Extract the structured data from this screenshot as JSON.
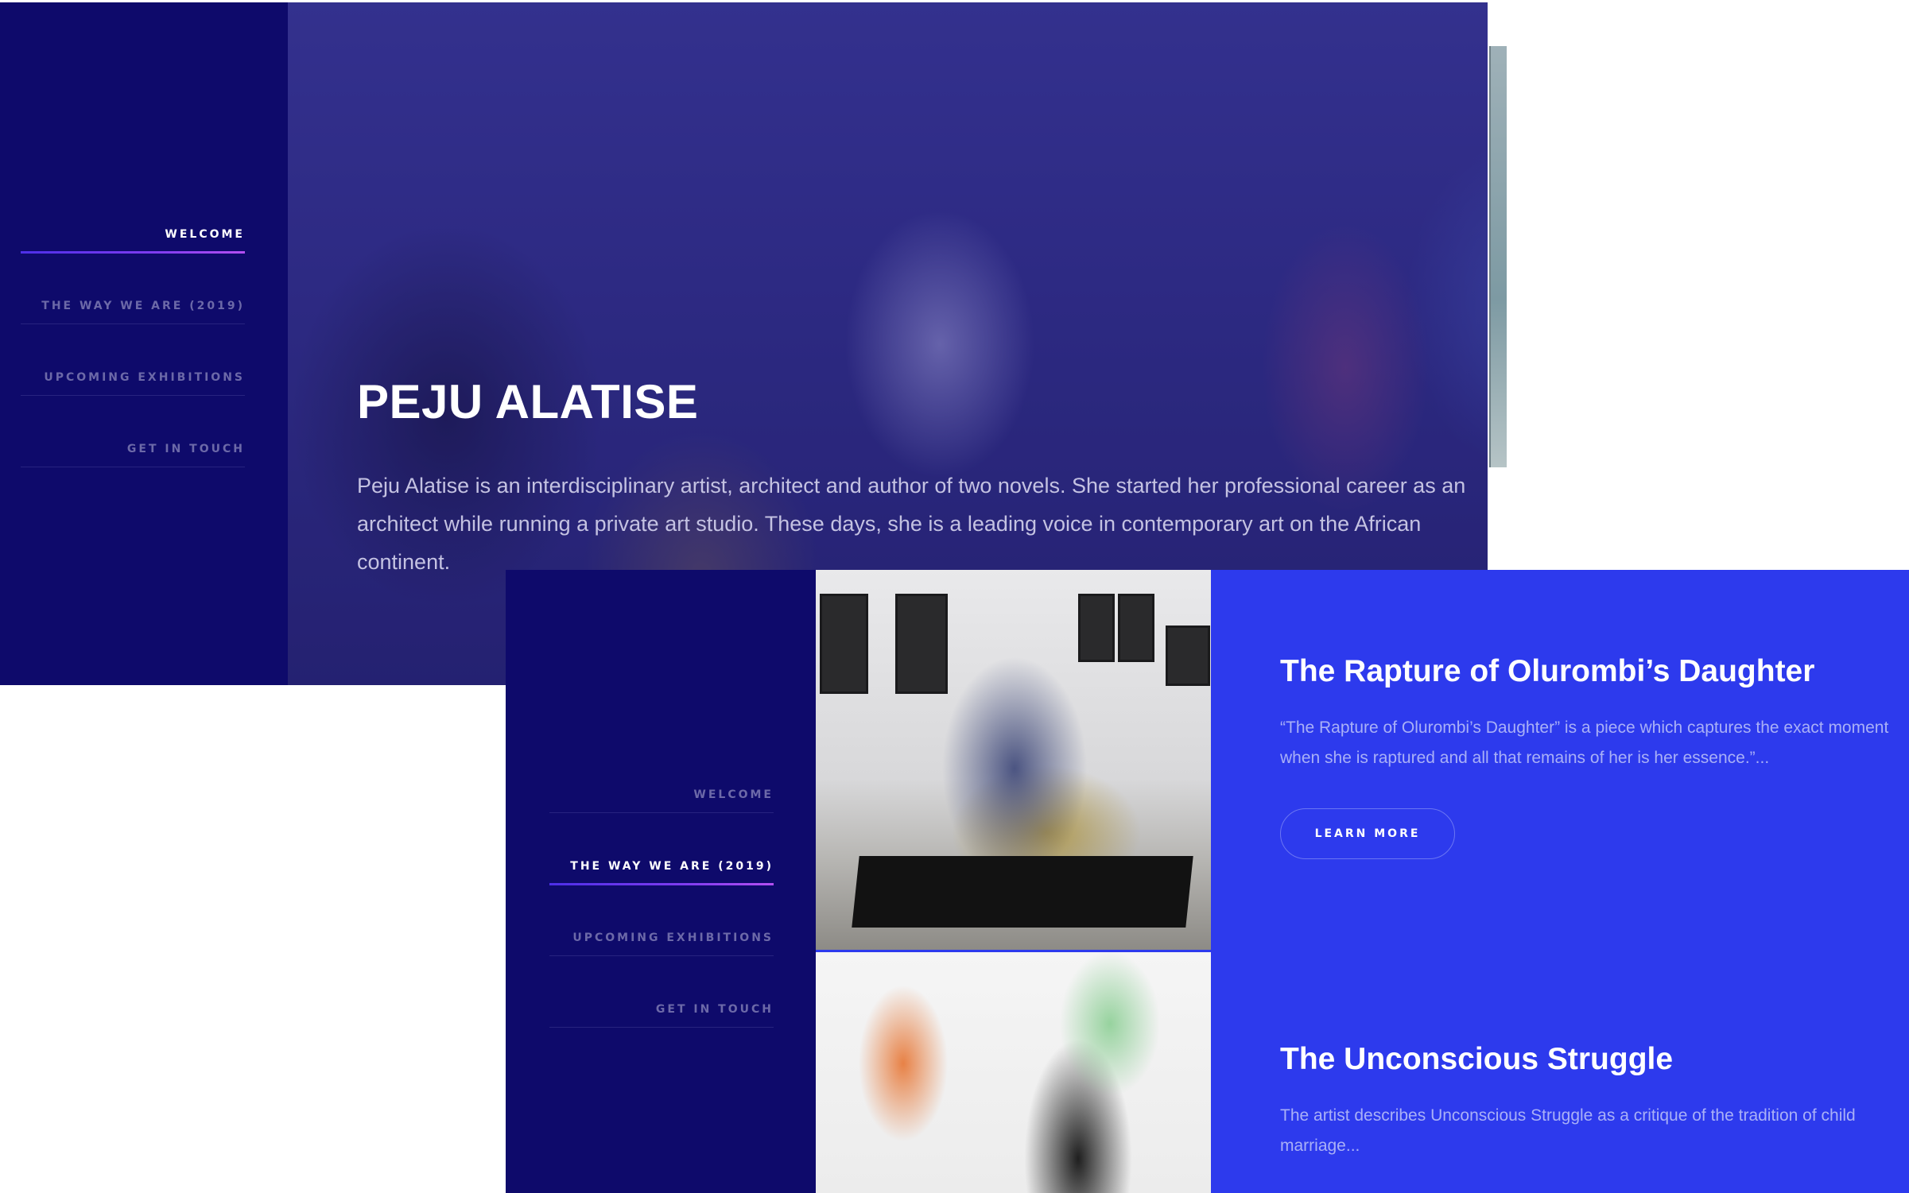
{
  "colors": {
    "sidebar_bg": "#0e0a6b",
    "accent_underline": "#7f3cf0",
    "works_bg": "#2d3aed",
    "nav_inactive": "#6c69a8"
  },
  "screen_1": {
    "nav": {
      "items": [
        {
          "label": "WELCOME",
          "active": true
        },
        {
          "label": "THE WAY WE ARE (2019)",
          "active": false
        },
        {
          "label": "UPCOMING EXHIBITIONS",
          "active": false
        },
        {
          "label": "GET IN TOUCH",
          "active": false
        }
      ]
    },
    "hero": {
      "title": "PEJU ALATISE",
      "description": "Peju Alatise is an interdisciplinary artist, architect and author of two novels. She started her professional career as an architect while running a private art studio. These days, she is a leading voice in contemporary art on the African continent."
    }
  },
  "screen_2": {
    "nav": {
      "items": [
        {
          "label": "WELCOME",
          "active": false
        },
        {
          "label": "THE WAY WE ARE (2019)",
          "active": true
        },
        {
          "label": "UPCOMING EXHIBITIONS",
          "active": false
        },
        {
          "label": "GET IN TOUCH",
          "active": false
        }
      ]
    },
    "works": [
      {
        "title": "The Rapture of Olurombi’s Daughter",
        "description": "“The Rapture of Olurombi’s Daughter” is a piece which captures the exact moment when she is raptured and all that remains of her is her essence.”...",
        "button": "LEARN MORE"
      },
      {
        "title": "The Unconscious Struggle",
        "description": "The artist describes Unconscious Struggle as a critique of the tradition of child marriage..."
      }
    ]
  }
}
